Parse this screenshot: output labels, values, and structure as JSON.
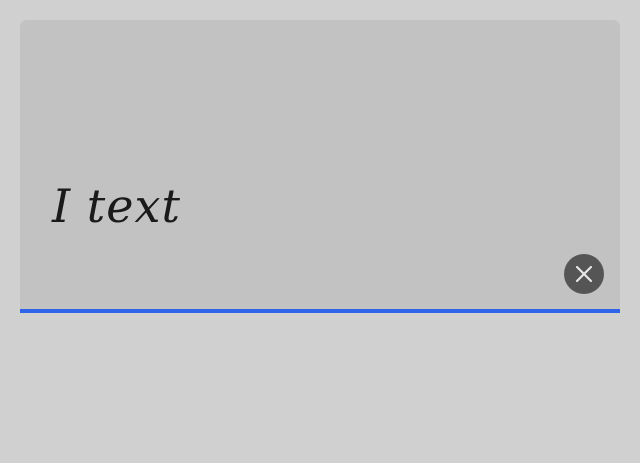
{
  "text_field": {
    "value": "I text",
    "clear_icon": "close-icon"
  },
  "colors": {
    "page_background": "#d0d0d0",
    "field_background": "#c2c2c2",
    "clear_button": "#555555",
    "focus_underline": "#2f63e8"
  }
}
